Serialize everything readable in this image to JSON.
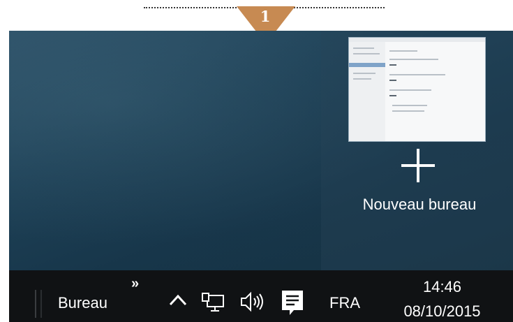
{
  "step": {
    "number": "1",
    "color": "#c78a52"
  },
  "new_desktop": {
    "label": "Nouveau bureau"
  },
  "taskbar": {
    "toolbar_label": "Bureau",
    "toolbar_expand": "»",
    "tray_icons": [
      "chevron-up-icon",
      "network-icon",
      "volume-icon",
      "notifications-icon"
    ],
    "language": "FRA",
    "time": "14:46",
    "date": "08/10/2015"
  },
  "colors": {
    "taskbar": "#101214",
    "desktop": "#1e4157",
    "accent": "#7fa3c8"
  }
}
